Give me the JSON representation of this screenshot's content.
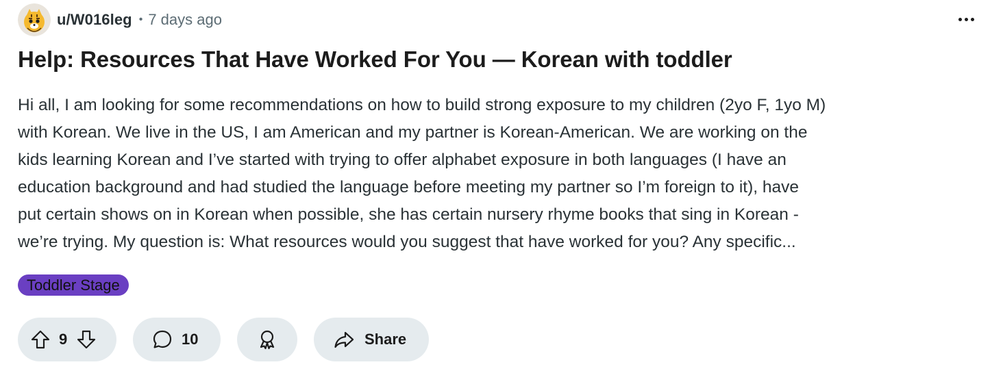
{
  "post": {
    "author": "u/W016leg",
    "separator": "•",
    "time": "7 days ago",
    "title": "Help: Resources That Have Worked For You — Korean with toddler",
    "body_lines": [
      "Hi all, I am looking for some recommendations on how to build strong exposure to my children (2yo F, 1yo M)",
      "with Korean. We live in the US, I am American and my partner is Korean-American. We are working on the",
      "kids learning Korean and I’ve started with trying to offer alphabet exposure in both languages (I have an",
      "education background and had studied the language before meeting my partner so I’m foreign to it), have",
      "put certain shows on in Korean when possible, she has certain nursery rhyme books that sing in Korean -",
      "we’re trying. My question is: What resources would you suggest that have worked for you? Any specific..."
    ],
    "flair": "Toddler Stage",
    "flair_color": "#6a3fc2"
  },
  "actions": {
    "vote_count": "9",
    "comment_count": "10",
    "share_label": "Share"
  },
  "icons": {
    "overflow": "more-horizontal-icon",
    "upvote": "arrow-up-icon",
    "downvote": "arrow-down-icon",
    "comment": "speech-bubble-icon",
    "award": "award-ribbon-icon",
    "share": "share-arrow-icon"
  },
  "colors": {
    "pill_background": "#e5ebee",
    "meta_text": "#5c6c74",
    "title_text": "#1c1c1c"
  }
}
